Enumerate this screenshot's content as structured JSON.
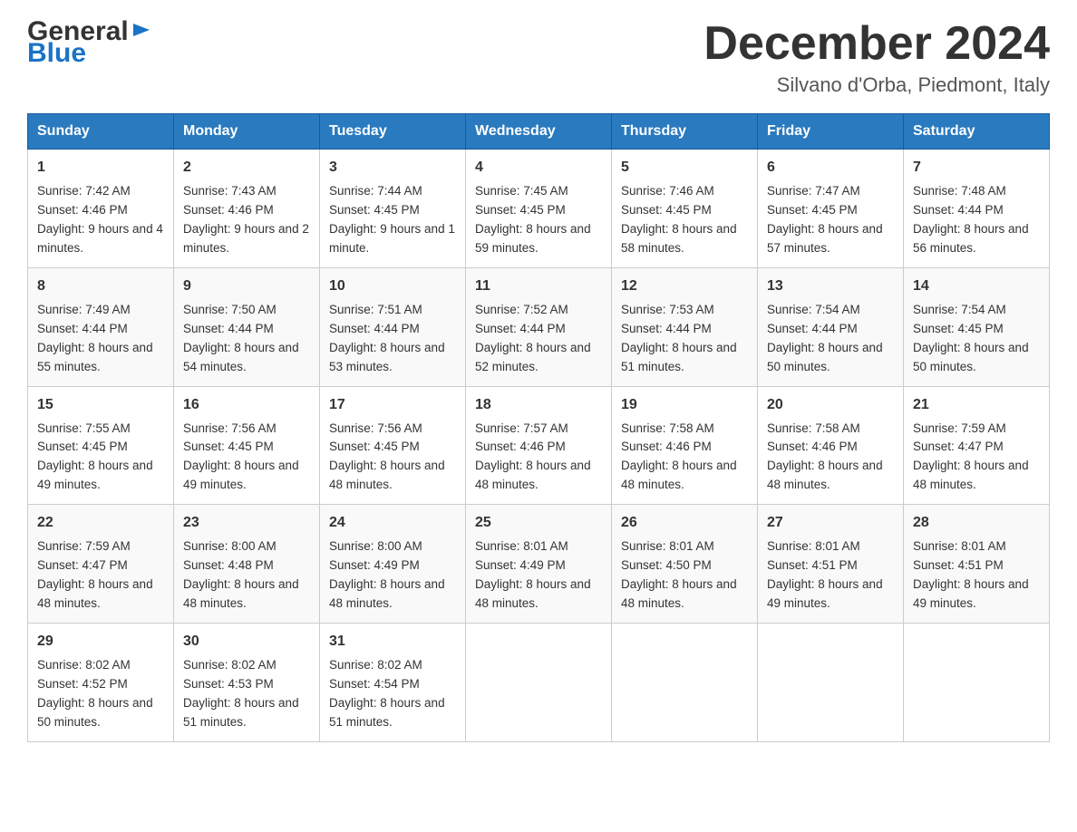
{
  "header": {
    "title": "December 2024",
    "subtitle": "Silvano d'Orba, Piedmont, Italy",
    "logo_line1": "General",
    "logo_line2": "Blue"
  },
  "calendar": {
    "days_of_week": [
      "Sunday",
      "Monday",
      "Tuesday",
      "Wednesday",
      "Thursday",
      "Friday",
      "Saturday"
    ],
    "weeks": [
      [
        {
          "day": "1",
          "sunrise": "7:42 AM",
          "sunset": "4:46 PM",
          "daylight": "9 hours and 4 minutes."
        },
        {
          "day": "2",
          "sunrise": "7:43 AM",
          "sunset": "4:46 PM",
          "daylight": "9 hours and 2 minutes."
        },
        {
          "day": "3",
          "sunrise": "7:44 AM",
          "sunset": "4:45 PM",
          "daylight": "9 hours and 1 minute."
        },
        {
          "day": "4",
          "sunrise": "7:45 AM",
          "sunset": "4:45 PM",
          "daylight": "8 hours and 59 minutes."
        },
        {
          "day": "5",
          "sunrise": "7:46 AM",
          "sunset": "4:45 PM",
          "daylight": "8 hours and 58 minutes."
        },
        {
          "day": "6",
          "sunrise": "7:47 AM",
          "sunset": "4:45 PM",
          "daylight": "8 hours and 57 minutes."
        },
        {
          "day": "7",
          "sunrise": "7:48 AM",
          "sunset": "4:44 PM",
          "daylight": "8 hours and 56 minutes."
        }
      ],
      [
        {
          "day": "8",
          "sunrise": "7:49 AM",
          "sunset": "4:44 PM",
          "daylight": "8 hours and 55 minutes."
        },
        {
          "day": "9",
          "sunrise": "7:50 AM",
          "sunset": "4:44 PM",
          "daylight": "8 hours and 54 minutes."
        },
        {
          "day": "10",
          "sunrise": "7:51 AM",
          "sunset": "4:44 PM",
          "daylight": "8 hours and 53 minutes."
        },
        {
          "day": "11",
          "sunrise": "7:52 AM",
          "sunset": "4:44 PM",
          "daylight": "8 hours and 52 minutes."
        },
        {
          "day": "12",
          "sunrise": "7:53 AM",
          "sunset": "4:44 PM",
          "daylight": "8 hours and 51 minutes."
        },
        {
          "day": "13",
          "sunrise": "7:54 AM",
          "sunset": "4:44 PM",
          "daylight": "8 hours and 50 minutes."
        },
        {
          "day": "14",
          "sunrise": "7:54 AM",
          "sunset": "4:45 PM",
          "daylight": "8 hours and 50 minutes."
        }
      ],
      [
        {
          "day": "15",
          "sunrise": "7:55 AM",
          "sunset": "4:45 PM",
          "daylight": "8 hours and 49 minutes."
        },
        {
          "day": "16",
          "sunrise": "7:56 AM",
          "sunset": "4:45 PM",
          "daylight": "8 hours and 49 minutes."
        },
        {
          "day": "17",
          "sunrise": "7:56 AM",
          "sunset": "4:45 PM",
          "daylight": "8 hours and 48 minutes."
        },
        {
          "day": "18",
          "sunrise": "7:57 AM",
          "sunset": "4:46 PM",
          "daylight": "8 hours and 48 minutes."
        },
        {
          "day": "19",
          "sunrise": "7:58 AM",
          "sunset": "4:46 PM",
          "daylight": "8 hours and 48 minutes."
        },
        {
          "day": "20",
          "sunrise": "7:58 AM",
          "sunset": "4:46 PM",
          "daylight": "8 hours and 48 minutes."
        },
        {
          "day": "21",
          "sunrise": "7:59 AM",
          "sunset": "4:47 PM",
          "daylight": "8 hours and 48 minutes."
        }
      ],
      [
        {
          "day": "22",
          "sunrise": "7:59 AM",
          "sunset": "4:47 PM",
          "daylight": "8 hours and 48 minutes."
        },
        {
          "day": "23",
          "sunrise": "8:00 AM",
          "sunset": "4:48 PM",
          "daylight": "8 hours and 48 minutes."
        },
        {
          "day": "24",
          "sunrise": "8:00 AM",
          "sunset": "4:49 PM",
          "daylight": "8 hours and 48 minutes."
        },
        {
          "day": "25",
          "sunrise": "8:01 AM",
          "sunset": "4:49 PM",
          "daylight": "8 hours and 48 minutes."
        },
        {
          "day": "26",
          "sunrise": "8:01 AM",
          "sunset": "4:50 PM",
          "daylight": "8 hours and 48 minutes."
        },
        {
          "day": "27",
          "sunrise": "8:01 AM",
          "sunset": "4:51 PM",
          "daylight": "8 hours and 49 minutes."
        },
        {
          "day": "28",
          "sunrise": "8:01 AM",
          "sunset": "4:51 PM",
          "daylight": "8 hours and 49 minutes."
        }
      ],
      [
        {
          "day": "29",
          "sunrise": "8:02 AM",
          "sunset": "4:52 PM",
          "daylight": "8 hours and 50 minutes."
        },
        {
          "day": "30",
          "sunrise": "8:02 AM",
          "sunset": "4:53 PM",
          "daylight": "8 hours and 51 minutes."
        },
        {
          "day": "31",
          "sunrise": "8:02 AM",
          "sunset": "4:54 PM",
          "daylight": "8 hours and 51 minutes."
        },
        null,
        null,
        null,
        null
      ]
    ]
  }
}
